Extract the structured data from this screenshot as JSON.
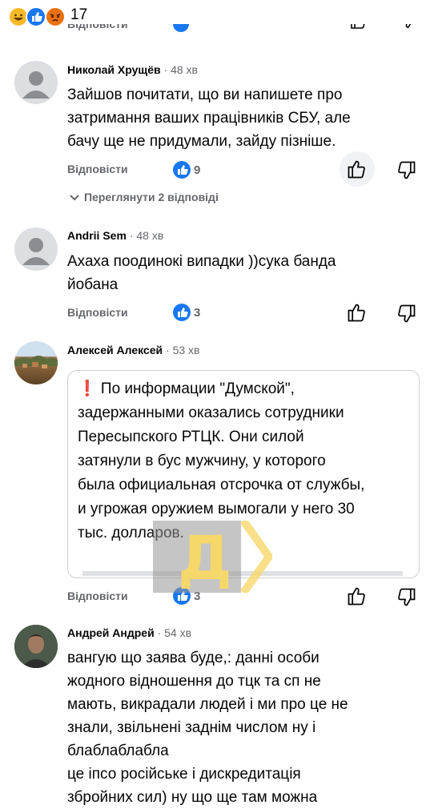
{
  "reactions": {
    "count": "17",
    "colors": [
      "#f7b928",
      "#1877f2",
      "#e9710f"
    ]
  },
  "cut_reply": "Відповісти",
  "comments": [
    {
      "author": "Николай Хрущёв",
      "time": "48 хв",
      "lines": [
        "Зайшов почитати, що ви напишете про",
        "затримання ваших працівників СБУ, але",
        "бачу ще не придумали, зайду пізніше."
      ],
      "reply": "Відповісти",
      "likes": "9",
      "view_replies": "Переглянути 2 відповіді"
    },
    {
      "author": "Andrii Sem",
      "time": "48 хв",
      "lines": [
        "Ахаха поодинокі випадки ))сука банда",
        "йобана"
      ],
      "reply": "Відповісти",
      "likes": "3"
    },
    {
      "author": "Алексей Алексей",
      "time": "53 хв",
      "quote_lines": [
        "❗ По информации \"Думской\",",
        "задержанными оказались сотрудники",
        "Пересыпского РТЦК. Они силой",
        "затянули в бус мужчину, у которого",
        "была официальная отсрочка от службы,",
        "и угрожая оружием вымогали у него 30",
        "тыс. долларов."
      ],
      "reply": "Відповісти",
      "likes": "3"
    },
    {
      "author": "Андрей Андрей",
      "time": "54 хв",
      "lines": [
        "вангую що заява буде,: данні особи",
        "жодного відношення до тцк та сп не",
        "мають, викрадали людей і ми про це не",
        "знали, звільнені заднім числом ну і",
        "блаблаблабла",
        "це іпсо російське і дискредитація",
        "збройних сил) ну що ще там можна"
      ]
    }
  ],
  "watermark": {
    "letter": "Д",
    "color": "#f6d76a"
  }
}
